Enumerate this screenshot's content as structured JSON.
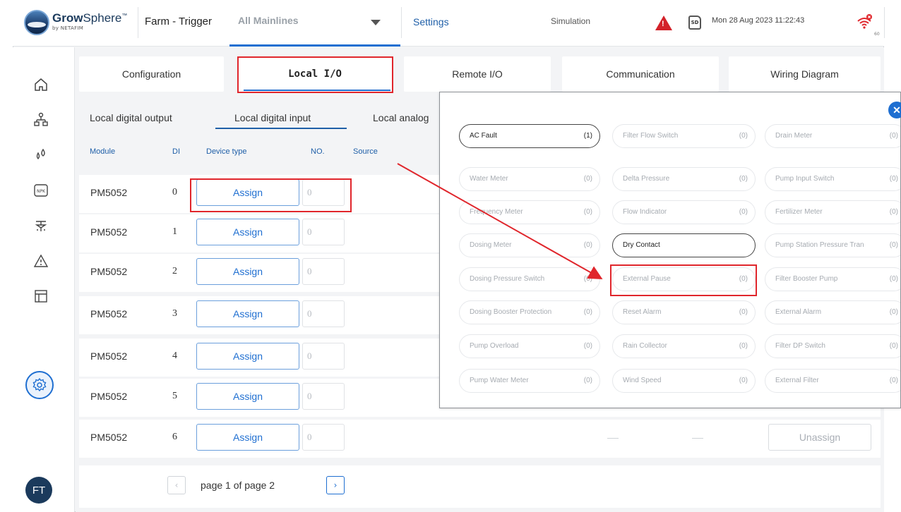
{
  "topbar": {
    "brand_main": "Grow",
    "brand_rest": "Sphere",
    "brand_tm": "™",
    "brand_sub": "by NETAFIM",
    "farm": "Farm - Trigger",
    "mainlines": "All Mainlines",
    "settings": "Settings",
    "simulation": "Simulation",
    "sd": "SD",
    "datetime": "Mon 28 Aug 2023  11:22:43",
    "wifi_value": "60"
  },
  "sidebar": {
    "items": [
      "home-icon",
      "hierarchy-icon",
      "water-drops-icon",
      "npk-icon",
      "irrigation-icon",
      "alarm-icon",
      "layout-icon",
      "settings-gear-icon"
    ],
    "npk_label": "NPK",
    "avatar": "FT"
  },
  "tabs": [
    "Configuration",
    "Local I/O",
    "Remote I/O",
    "Communication",
    "Wiring Diagram"
  ],
  "subtabs": [
    "Local digital output",
    "Local digital input",
    "Local analog"
  ],
  "columns": [
    "Module",
    "DI",
    "Device type",
    "NO.",
    "Source"
  ],
  "rows": [
    {
      "module": "PM5052",
      "di": "0",
      "assign": "Assign",
      "no": "0"
    },
    {
      "module": "PM5052",
      "di": "1",
      "assign": "Assign",
      "no": "0"
    },
    {
      "module": "PM5052",
      "di": "2",
      "assign": "Assign",
      "no": "0"
    },
    {
      "module": "PM5052",
      "di": "3",
      "assign": "Assign",
      "no": "0"
    },
    {
      "module": "PM5052",
      "di": "4",
      "assign": "Assign",
      "no": "0"
    },
    {
      "module": "PM5052",
      "di": "5",
      "assign": "Assign",
      "no": "0"
    },
    {
      "module": "PM5052",
      "di": "6",
      "assign": "Assign",
      "no": "0",
      "unassign": "Unassign"
    }
  ],
  "pager": {
    "prev": "‹",
    "text": "page 1 of page  2",
    "next": "›"
  },
  "popup": {
    "close": "✕",
    "chips": [
      {
        "label": "AC Fault",
        "count": "(1)",
        "active": true
      },
      {
        "label": "Filter Flow Switch",
        "count": "(0)"
      },
      {
        "label": "Drain Meter",
        "count": "(0)"
      },
      {
        "label": "Water Meter",
        "count": "(0)"
      },
      {
        "label": "Delta Pressure",
        "count": "(0)"
      },
      {
        "label": "Pump Input Switch",
        "count": "(0)"
      },
      {
        "label": "Frequency Meter",
        "count": "(0)"
      },
      {
        "label": "Flow Indicator",
        "count": "(0)"
      },
      {
        "label": "Fertilizer Meter",
        "count": "(0)"
      },
      {
        "label": "Dosing Meter",
        "count": "(0)"
      },
      {
        "label": "Dry Contact",
        "count": "",
        "active": true
      },
      {
        "label": "Pump Station Pressure Tran",
        "count": "(0)"
      },
      {
        "label": "Dosing Pressure Switch",
        "count": "(0)"
      },
      {
        "label": "External Pause",
        "count": "(0)"
      },
      {
        "label": "Filter Booster Pump",
        "count": "(0)"
      },
      {
        "label": "Dosing Booster Protection",
        "count": "(0)"
      },
      {
        "label": "Reset Alarm",
        "count": "(0)"
      },
      {
        "label": "External Alarm",
        "count": "(0)"
      },
      {
        "label": "Pump Overload",
        "count": "(0)"
      },
      {
        "label": "Rain Collector",
        "count": "(0)"
      },
      {
        "label": "Filter DP Switch",
        "count": "(0)"
      },
      {
        "label": "Pump Water Meter",
        "count": "(0)"
      },
      {
        "label": "Wind Speed",
        "count": "(0)"
      },
      {
        "label": "External Filter",
        "count": "(0)"
      }
    ]
  },
  "colors": {
    "accent": "#1f6fd1",
    "highlight": "#e0262c",
    "alert": "#d3222a",
    "brand_dark": "#1b3a5c"
  }
}
